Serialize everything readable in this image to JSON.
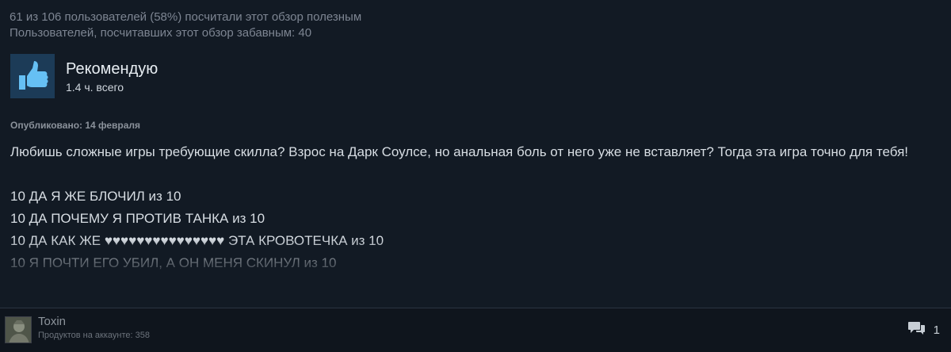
{
  "helpful": {
    "line1": "61 из 106 пользователей (58%) посчитали этот обзор полезным",
    "line2": "Пользователей, посчитавших этот обзор забавным: 40"
  },
  "vote": {
    "icon": "thumbs-up-icon",
    "title": "Рекомендую",
    "hours": "1.4 ч. всего"
  },
  "posted": "Опубликовано: 14 февраля",
  "content": {
    "paragraph1": "Любишь сложные игры требующие скилла? Взрос на Дарк Соулсе, но анальная боль от него уже не вставляет? Тогда эта игра точно для тебя!",
    "lines": [
      "10 ДА Я ЖЕ БЛОЧИЛ из 10",
      "10 ДА ПОЧЕМУ Я ПРОТИВ ТАНКА из 10",
      "10 ДА КАК ЖЕ ♥♥♥♥♥♥♥♥♥♥♥♥♥♥♥ ЭТА КРОВОТЕЧКА из 10",
      "10 Я ПОЧТИ ЕГО УБИЛ, А ОН МЕНЯ СКИНУЛ из 10"
    ]
  },
  "author": {
    "name": "Toxin",
    "products": "Продуктов на аккаунте: 358"
  },
  "comments": {
    "icon": "comment-bubbles-icon",
    "count": "1"
  },
  "colors": {
    "background": "#121a24",
    "footer": "#0f151d",
    "thumb_box": "#1c3b57",
    "thumb_icon": "#66c0f4"
  }
}
